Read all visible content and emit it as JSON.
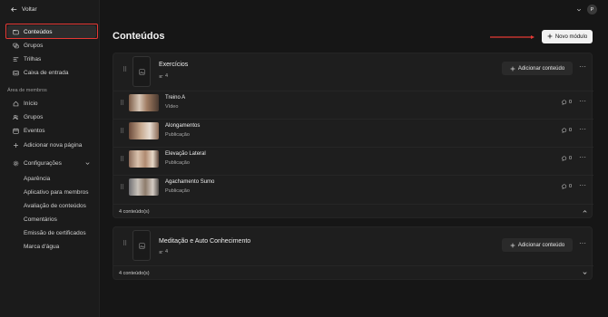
{
  "sidebar": {
    "back_label": "Voltar",
    "items": [
      {
        "label": "Conteúdos",
        "icon": "folder-icon"
      },
      {
        "label": "Grupos",
        "icon": "chat-icon"
      },
      {
        "label": "Trilhas",
        "icon": "list-icon"
      },
      {
        "label": "Caixa de entrada",
        "icon": "inbox-icon"
      }
    ],
    "members_section_label": "Área de membros",
    "member_items": [
      {
        "label": "Início",
        "icon": "home-icon"
      },
      {
        "label": "Grupos",
        "icon": "users-icon"
      },
      {
        "label": "Eventos",
        "icon": "calendar-icon"
      },
      {
        "label": "Adicionar nova página",
        "icon": "plus-icon"
      }
    ],
    "settings_label": "Configurações",
    "settings_items": [
      "Aparência",
      "Aplicativo para membros",
      "Avaliação de conteúdos",
      "Comentários",
      "Emissão de certificados",
      "Marca d'água"
    ]
  },
  "topbar": {
    "avatar_initial": "P"
  },
  "main": {
    "title": "Conteúdos",
    "new_module_label": "Novo módulo",
    "modules": [
      {
        "title": "Exercícios",
        "count": "4",
        "add_label": "Adicionar conteúdo",
        "footer": "4 conteúdo(s)",
        "expanded": true,
        "rows": [
          {
            "title": "Treino A",
            "type": "Vídeo",
            "comments": "0"
          },
          {
            "title": "Alongamentos",
            "type": "Publicação",
            "comments": "0"
          },
          {
            "title": "Elevação Lateral",
            "type": "Publicação",
            "comments": "0"
          },
          {
            "title": "Agachamento Sumo",
            "type": "Publicação",
            "comments": "0"
          }
        ]
      },
      {
        "title": "Meditação e Auto Conhecimento",
        "count": "4",
        "add_label": "Adicionar conteúdo",
        "footer": "4 conteúdo(s)",
        "expanded": false
      }
    ]
  },
  "colors": {
    "background": "#161616",
    "sidebar": "#1b1b1b",
    "highlight": "#e53935",
    "primary_button": "#f2f2f2"
  }
}
